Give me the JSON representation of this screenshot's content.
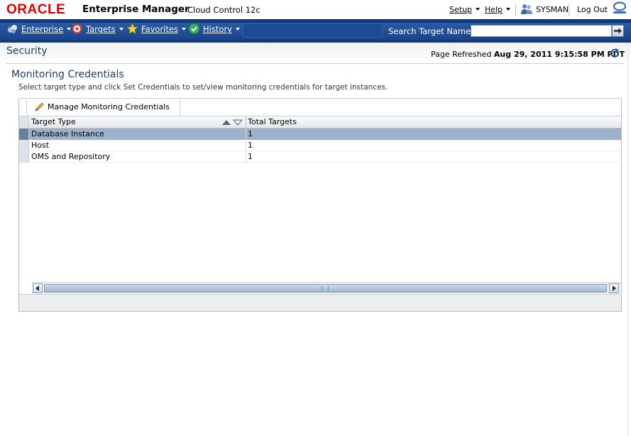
{
  "brand": {
    "oracle": "ORACLE",
    "product": "Enterprise Manager",
    "edition": "Cloud Control 12c"
  },
  "top_menu": {
    "setup": "Setup",
    "help": "Help",
    "user": "SYSMAN",
    "logout": "Log Out"
  },
  "nav": {
    "items": [
      {
        "label": "Enterprise",
        "icon": "enterprise-icon"
      },
      {
        "label": "Targets",
        "icon": "targets-icon"
      },
      {
        "label": "Favorites",
        "icon": "star-icon"
      },
      {
        "label": "History",
        "icon": "history-icon"
      }
    ],
    "search_label": "Search Target Name",
    "search_value": ""
  },
  "page": {
    "title": "Security",
    "refreshed_label": "Page Refreshed",
    "refreshed_value": "Aug 29, 2011 9:15:58 PM PDT"
  },
  "section": {
    "title": "Monitoring Credentials",
    "description": "Select target type and click Set Credentials to set/view monitoring credentials for target instances."
  },
  "toolbar": {
    "manage_label": "Manage Monitoring Credentials"
  },
  "table": {
    "columns": [
      "Target Type",
      "Total Targets"
    ],
    "rows": [
      {
        "target_type": "Database Instance",
        "total": "1",
        "selected": true
      },
      {
        "target_type": "Host",
        "total": "1",
        "selected": false
      },
      {
        "target_type": "OMS and Repository",
        "total": "1",
        "selected": false
      }
    ]
  },
  "colors": {
    "nav_bg": "#1a4489",
    "title_blue": "#1f3f6b",
    "selected_row": "#9db0cc",
    "oracle_red": "#e00000"
  }
}
